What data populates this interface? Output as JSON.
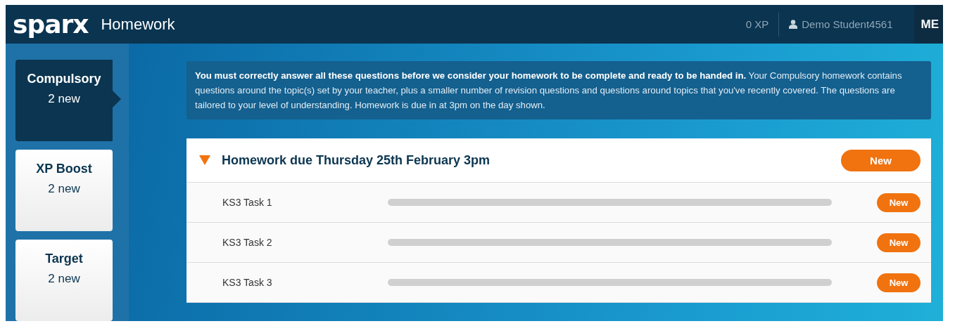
{
  "header": {
    "logo": "sparx",
    "title": "Homework",
    "xp": "0 XP",
    "user": "Demo Student4561",
    "menu": "ME"
  },
  "sidebar": {
    "items": [
      {
        "label": "Compulsory",
        "count": "2 new",
        "selected": true
      },
      {
        "label": "XP Boost",
        "count": "2 new",
        "selected": false
      },
      {
        "label": "Target",
        "count": "2 new",
        "selected": false
      }
    ]
  },
  "info": "**You must correctly answer all these questions before we consider your homework to be complete and ready to be handed in.** Your Compulsory homework contains questions around the topic(s) set by your teacher, plus a smaller number of revision questions and questions around topics that you've recently covered. The questions are tailored to your level of understanding. Homework is due in at 3pm on the day shown.",
  "homework": {
    "title": "Homework due Thursday 25th February 3pm",
    "expanded": true,
    "badge": "New",
    "tasks": [
      {
        "label": "KS3 Task 1",
        "level": 0,
        "badge": "New"
      },
      {
        "label": "KS3 Task 2",
        "level": 0,
        "badge": "New"
      },
      {
        "label": "KS3 Task 3",
        "level": 0,
        "badge": "New"
      }
    ]
  }
}
